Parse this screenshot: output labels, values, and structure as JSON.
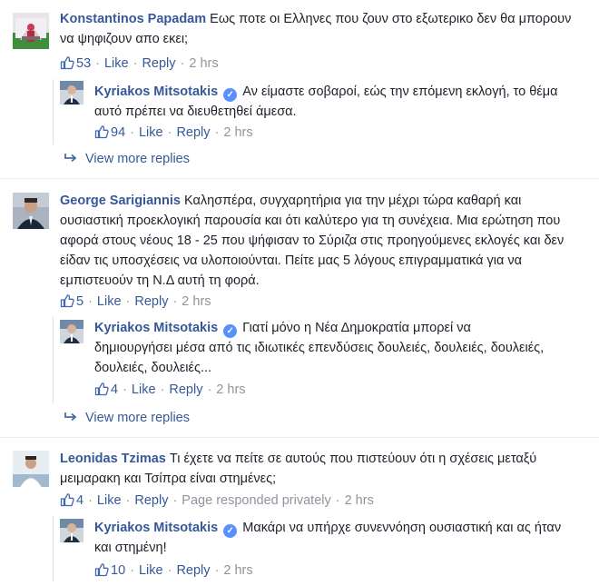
{
  "comments": [
    {
      "author": "Konstantinos Papadam",
      "text": "Εως ποτε οι Ελληνες που ζουν στο εξωτερικο δεν θα μπορουν να ψηφιζουν απο εκει;",
      "likes": "53",
      "like_label": "Like",
      "reply_label": "Reply",
      "time": "2 hrs",
      "reply": {
        "author": "Kyriakos Mitsotakis",
        "text": "Αν είμαστε σοβαροί, εώς την επόμενη εκλογή, το θέμα αυτό πρέπει να διευθετηθεί άμεσα.",
        "likes": "94",
        "like_label": "Like",
        "reply_label": "Reply",
        "time": "2 hrs"
      },
      "view_more": "View more replies"
    },
    {
      "author": "George Sarigiannis",
      "text": "Καλησπέρα, συγχαρητήρια για την μέχρι τώρα καθαρή και ουσιαστική προεκλογική παρουσία και ότι καλύτερο για τη συνέχεια. Μια ερώτηση που αφορά στους νέους 18 - 25 που ψήφισαν το Σύριζα στις προηγούμενες εκλογές και δεν είδαν τις υποσχέσεις να υλοποιούνται. Πείτε μας 5 λόγους επιγραμματικά για να εμπιστευούν τη Ν.Δ αυτή τη φορά.",
      "likes": "5",
      "like_label": "Like",
      "reply_label": "Reply",
      "time": "2 hrs",
      "reply": {
        "author": "Kyriakos Mitsotakis",
        "text": "Γιατί μόνο η Νέα Δημοκρατία μπορεί να δημιουργήσει μέσα από τις ιδιωτικές επενδύσεις δουλειές, δουλειές, δουλειές, δουλειές, δουλειές...",
        "likes": "4",
        "like_label": "Like",
        "reply_label": "Reply",
        "time": "2 hrs"
      },
      "view_more": "View more replies"
    },
    {
      "author": "Leonidas Tzimas",
      "text": "Τι έχετε να πείτε σε αυτούς που πιστεύουν ότι η σχέσεις μεταξύ μειμαρακη και Τσίπρα είναι στημένες;",
      "likes": "4",
      "like_label": "Like",
      "reply_label": "Reply",
      "page_note": "Page responded privately",
      "time": "2 hrs",
      "reply": {
        "author": "Kyriakos Mitsotakis",
        "text": "Μακάρι να υπήρχε συνεννόηση ουσιαστική και ας ήταν και στημένη!",
        "likes": "10",
        "like_label": "Like",
        "reply_label": "Reply",
        "time": "2 hrs"
      }
    }
  ],
  "colors": {
    "link": "#365899",
    "text": "#1d2129",
    "meta": "#90949c",
    "verified": "#5890ff"
  },
  "icons": {
    "like": "thumbs-up-icon",
    "verified": "verified-badge-icon",
    "reply_arrow": "reply-arrow-icon"
  }
}
